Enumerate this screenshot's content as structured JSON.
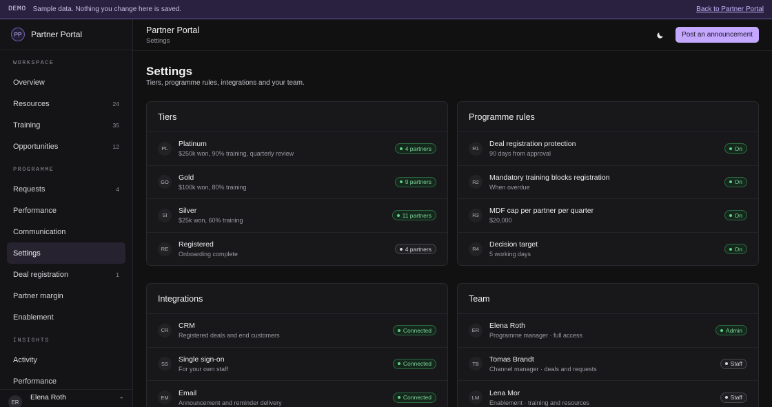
{
  "demo": {
    "tag": "DEMO",
    "text": "Sample data. Nothing you change here is saved.",
    "back_link": "Back to Partner Portal"
  },
  "brand": {
    "initials": "PP",
    "name": "Partner Portal"
  },
  "sidebar": {
    "sections": [
      {
        "label": "WORKSPACE",
        "items": [
          {
            "label": "Overview",
            "count": ""
          },
          {
            "label": "Resources",
            "count": "24"
          },
          {
            "label": "Training",
            "count": "35"
          },
          {
            "label": "Opportunities",
            "count": "12"
          }
        ]
      },
      {
        "label": "PROGRAMME",
        "items": [
          {
            "label": "Requests",
            "count": "4"
          },
          {
            "label": "Performance",
            "count": ""
          },
          {
            "label": "Communication",
            "count": ""
          },
          {
            "label": "Settings",
            "count": "",
            "active": true
          },
          {
            "label": "Deal registration",
            "count": "1"
          },
          {
            "label": "Partner margin",
            "count": ""
          },
          {
            "label": "Enablement",
            "count": ""
          }
        ]
      },
      {
        "label": "INSIGHTS",
        "items": [
          {
            "label": "Activity",
            "count": ""
          },
          {
            "label": "Performance",
            "count": ""
          }
        ]
      }
    ],
    "user": {
      "initials": "ER",
      "name": "Elena Roth"
    }
  },
  "topbar": {
    "title": "Partner Portal",
    "subtitle": "Settings",
    "post_label": "Post an announcement",
    "theme_icon": "moon-icon"
  },
  "page": {
    "title": "Settings",
    "subtitle": "Tiers, programme rules, integrations and your team."
  },
  "cards": [
    {
      "key": "tiers",
      "title": "Tiers",
      "rows": [
        {
          "code": "PL",
          "name": "Platinum",
          "desc": "$250k won, 90% training, quarterly review",
          "badge": "4 partners",
          "tone": "green"
        },
        {
          "code": "GO",
          "name": "Gold",
          "desc": "$100k won, 80% training",
          "badge": "9 partners",
          "tone": "green"
        },
        {
          "code": "SI",
          "name": "Silver",
          "desc": "$25k won, 60% training",
          "badge": "11 partners",
          "tone": "green"
        },
        {
          "code": "RE",
          "name": "Registered",
          "desc": "Onboarding complete",
          "badge": "4 partners",
          "tone": "gray"
        }
      ]
    },
    {
      "key": "rules",
      "title": "Programme rules",
      "rows": [
        {
          "code": "R1",
          "name": "Deal registration protection",
          "desc": "90 days from approval",
          "badge": "On",
          "tone": "green"
        },
        {
          "code": "R2",
          "name": "Mandatory training blocks registration",
          "desc": "When overdue",
          "badge": "On",
          "tone": "green"
        },
        {
          "code": "R3",
          "name": "MDF cap per partner per quarter",
          "desc": "$20,000",
          "badge": "On",
          "tone": "green"
        },
        {
          "code": "R4",
          "name": "Decision target",
          "desc": "5 working days",
          "badge": "On",
          "tone": "green"
        }
      ]
    },
    {
      "key": "integrations",
      "title": "Integrations",
      "rows": [
        {
          "code": "CR",
          "name": "CRM",
          "desc": "Registered deals and end customers",
          "badge": "Connected",
          "tone": "green"
        },
        {
          "code": "SS",
          "name": "Single sign-on",
          "desc": "For your own staff",
          "badge": "Connected",
          "tone": "green"
        },
        {
          "code": "EM",
          "name": "Email",
          "desc": "Announcement and reminder delivery",
          "badge": "Connected",
          "tone": "green"
        }
      ]
    },
    {
      "key": "team",
      "title": "Team",
      "rows": [
        {
          "code": "ER",
          "name": "Elena Roth",
          "desc": "Programme manager · full access",
          "badge": "Admin",
          "tone": "green"
        },
        {
          "code": "TB",
          "name": "Tomas Brandt",
          "desc": "Channel manager · deals and requests",
          "badge": "Staff",
          "tone": "gray"
        },
        {
          "code": "LM",
          "name": "Lena Mor",
          "desc": "Enablement · training and resources",
          "badge": "Staff",
          "tone": "gray"
        }
      ]
    }
  ]
}
